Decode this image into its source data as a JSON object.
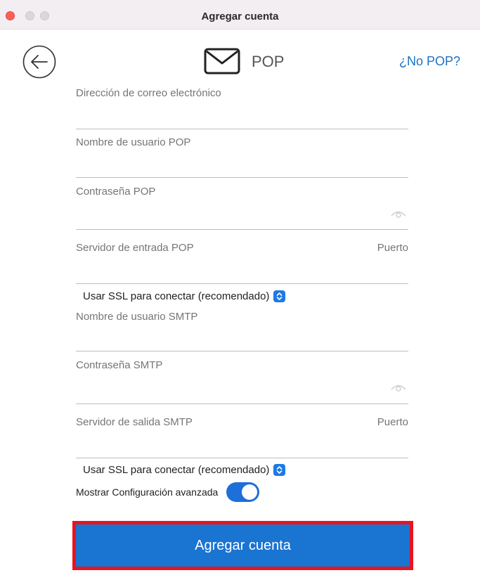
{
  "window": {
    "title": "Agregar cuenta"
  },
  "header": {
    "protocol": "POP",
    "alt_link": "¿No POP?"
  },
  "fields": {
    "email_label": "Dirección de correo electrónico",
    "pop_user_label": "Nombre de usuario POP",
    "pop_password_label": "Contraseña POP",
    "pop_server_label": "Servidor de entrada POP",
    "pop_port_label": "Puerto",
    "pop_ssl": "Usar SSL para conectar (recomendado)",
    "smtp_user_label": "Nombre de usuario SMTP",
    "smtp_password_label": "Contraseña SMTP",
    "smtp_server_label": "Servidor de salida SMTP",
    "smtp_port_label": "Puerto",
    "smtp_ssl": "Usar SSL para conectar (recomendado)"
  },
  "advanced": {
    "label": "Mostrar Configuración avanzada",
    "enabled": true
  },
  "actions": {
    "submit_label": "Agregar cuenta"
  },
  "colors": {
    "accent": "#1a74d1",
    "highlight": "#e8141f",
    "link": "#1a73c6"
  },
  "icons": {
    "back": "arrow-left-icon",
    "mail": "envelope-icon",
    "eye": "eye-icon",
    "stepper": "chevron-updown-icon"
  }
}
